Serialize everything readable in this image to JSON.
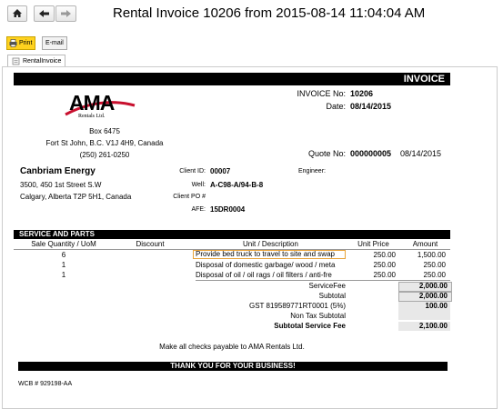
{
  "window_title": "Rental Invoice 10206 from 2015-08-14 11:04:04 AM",
  "toolbar": {
    "print_label": "Print",
    "email_label": "E-mail"
  },
  "tab_label": "RentalInvoice",
  "invoice": {
    "heading": "INVOICE",
    "invoice_no_label": "INVOICE No:",
    "invoice_no": "10206",
    "date_label": "Date:",
    "date": "08/14/2015",
    "logo_text": "AMA",
    "logo_sub": "Rentals Ltd.",
    "company_box": "Box 6475",
    "company_city": "Fort St John, B.C. V1J 4H9, Canada",
    "company_phone": "(250) 261-0250",
    "quote_label": "Quote No:",
    "quote_no": "000000005",
    "quote_date": "08/14/2015",
    "client_name": "Canbriam Energy",
    "client_addr1": "3500, 450 1st Street S.W",
    "client_addr2": "Calgary, Alberta T2P 5H1, Canada",
    "client_id_label": "Client ID:",
    "client_id": "00007",
    "engineer_label": "Engineer:",
    "well_label": "Well:",
    "well": "A-C98-A/94-B-8",
    "client_po_label": "Client PO #",
    "afe_label": "AFE:",
    "afe": "15DR0004",
    "section_title": "SERVICE AND PARTS",
    "columns": [
      "Sale Quantity / UoM",
      "Discount",
      "Unit / Description",
      "Unit Price",
      "Amount"
    ],
    "rows": [
      {
        "qty": "6",
        "desc": "Provide bed truck to travel to site and swap",
        "price": "250.00",
        "amount": "1,500.00"
      },
      {
        "qty": "1",
        "desc": "Disposal of domestic garbage/ wood / meta",
        "price": "250.00",
        "amount": "250.00"
      },
      {
        "qty": "1",
        "desc": "Disposal of oil / oil rags / oil filters / anti-fre",
        "price": "250.00",
        "amount": "250.00"
      }
    ],
    "service_fee_label": "ServiceFee",
    "service_fee": "2,000.00",
    "subtotal_label": "Subtotal",
    "subtotal": "2,000.00",
    "gst_label": "GST 819589771RT0001 (5%)",
    "gst": "100.00",
    "non_tax_label": "Non Tax Subtotal",
    "subtotal_service_label": "Subtotal Service Fee",
    "subtotal_service": "2,100.00",
    "payable_note": "Make all checks payable to AMA Rentals Ltd.",
    "thanks": "THANK YOU FOR YOUR BUSINESS!",
    "wcb": "WCB # 929198-AA"
  },
  "colors": {
    "accent_yellow": "#ffd21f",
    "highlight_border": "#e8a33a",
    "bar": "#000000"
  }
}
